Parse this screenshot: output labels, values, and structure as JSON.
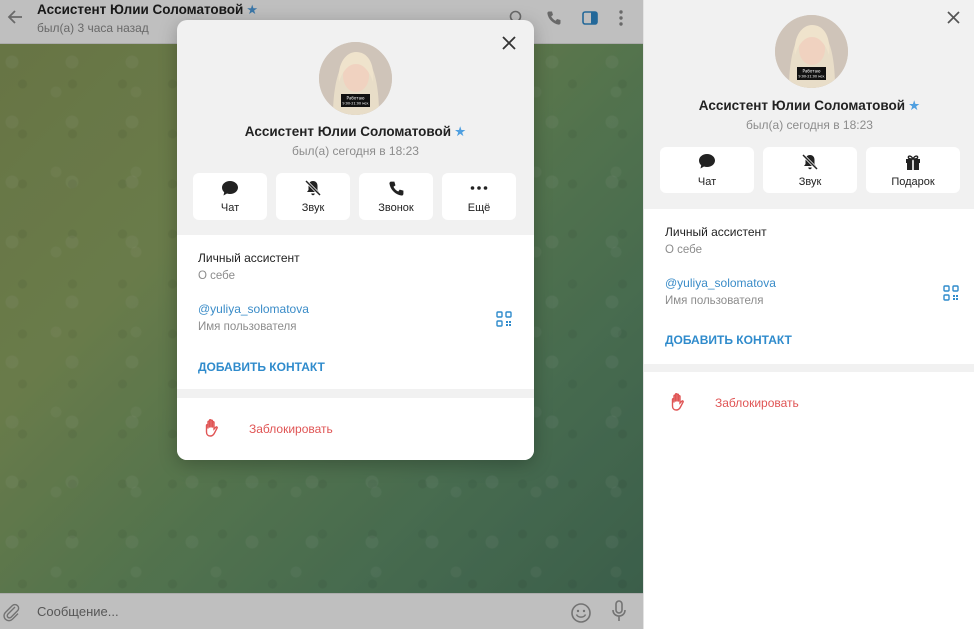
{
  "chat": {
    "title": "Ассистент Юлии Соломатовой",
    "status": "был(а) 3 часа назад",
    "composer_placeholder": "Сообщение..."
  },
  "profile": {
    "name": "Ассистент Юлии Соломатовой",
    "verified": true,
    "status": "был(а) сегодня в 18:23",
    "avatar_caption_line1": "Работаю",
    "avatar_caption_line2": "9:00-21:00 мск",
    "bio": "Личный ассистент",
    "bio_caption": "О себе",
    "username": "@yuliya_solomatova",
    "username_caption": "Имя пользователя",
    "add_contact": "ДОБАВИТЬ КОНТАКТ",
    "block": "Заблокировать"
  },
  "popup_actions": [
    {
      "label": "Чат",
      "icon": "chat-icon"
    },
    {
      "label": "Звук",
      "icon": "mute-icon"
    },
    {
      "label": "Звонок",
      "icon": "phone-icon"
    },
    {
      "label": "Ещё",
      "icon": "more-icon"
    }
  ],
  "panel_actions": [
    {
      "label": "Чат",
      "icon": "chat-icon"
    },
    {
      "label": "Звук",
      "icon": "mute-icon"
    },
    {
      "label": "Подарок",
      "icon": "gift-icon"
    }
  ],
  "colors": {
    "accent": "#2f8bcc",
    "danger": "#e05555",
    "verified_star": "#4f9fe0"
  }
}
